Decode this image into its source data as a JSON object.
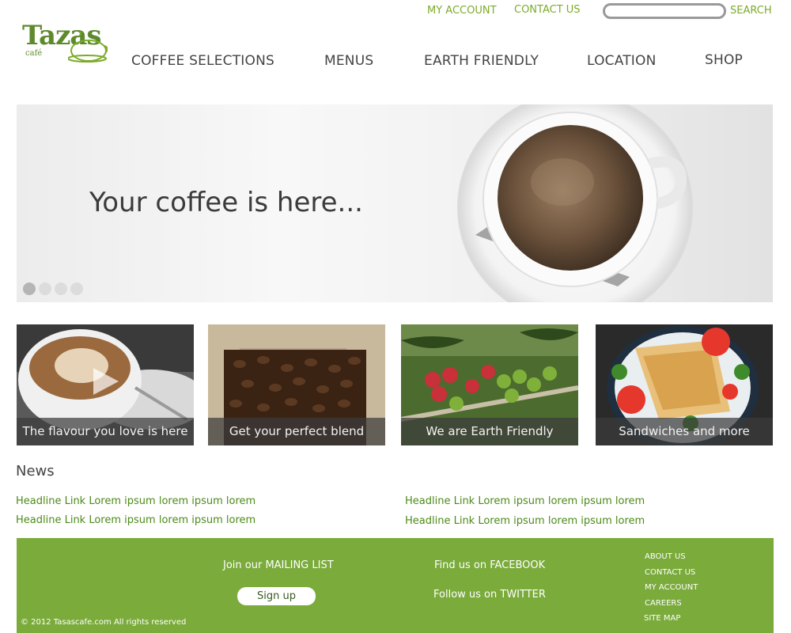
{
  "brand": {
    "logo_text": "Tazas",
    "logo_subtext": "café",
    "color": "#5e8a2e"
  },
  "top_links": {
    "my_account": "MY ACCOUNT",
    "contact_us": "CONTACT US",
    "search_label": "SEARCH",
    "search_value": ""
  },
  "nav": {
    "items": [
      {
        "label": "COFFEE SELECTIONS"
      },
      {
        "label": "MENUS"
      },
      {
        "label": "EARTH FRIENDLY"
      },
      {
        "label": "LOCATION"
      },
      {
        "label": "SHOP"
      }
    ]
  },
  "hero": {
    "headline": "Your coffee is here...",
    "slide_count": 4,
    "active_slide": 1
  },
  "tiles": [
    {
      "caption": "The flavour you love is here",
      "icon": "play-icon"
    },
    {
      "caption": "Get your perfect blend"
    },
    {
      "caption": "We are Earth Friendly"
    },
    {
      "caption": "Sandwiches and more"
    }
  ],
  "news": {
    "title": "News",
    "links": [
      "Headline Link Lorem ipsum lorem ipsum lorem",
      "Headline Link Lorem ipsum lorem ipsum lorem",
      "Headline Link Lorem ipsum lorem ipsum lorem",
      "Headline Link Lorem ipsum lorem ipsum lorem"
    ]
  },
  "footer": {
    "mailing_list": "Join our MAILING LIST",
    "signup": "Sign up",
    "facebook": "Find us on FACEBOOK",
    "twitter": "Follow us on TWITTER",
    "links": [
      "ABOUT US",
      "CONTACT US",
      "MY ACCOUNT",
      "CAREERS",
      "SITE MAP"
    ],
    "copyright": "© 2012 Tasascafe.com All rights reserved"
  },
  "colors": {
    "accent_green": "#7cab2a",
    "footer_green": "#7aab3b",
    "link_green": "#4c8a18",
    "text_dark": "#444444"
  }
}
